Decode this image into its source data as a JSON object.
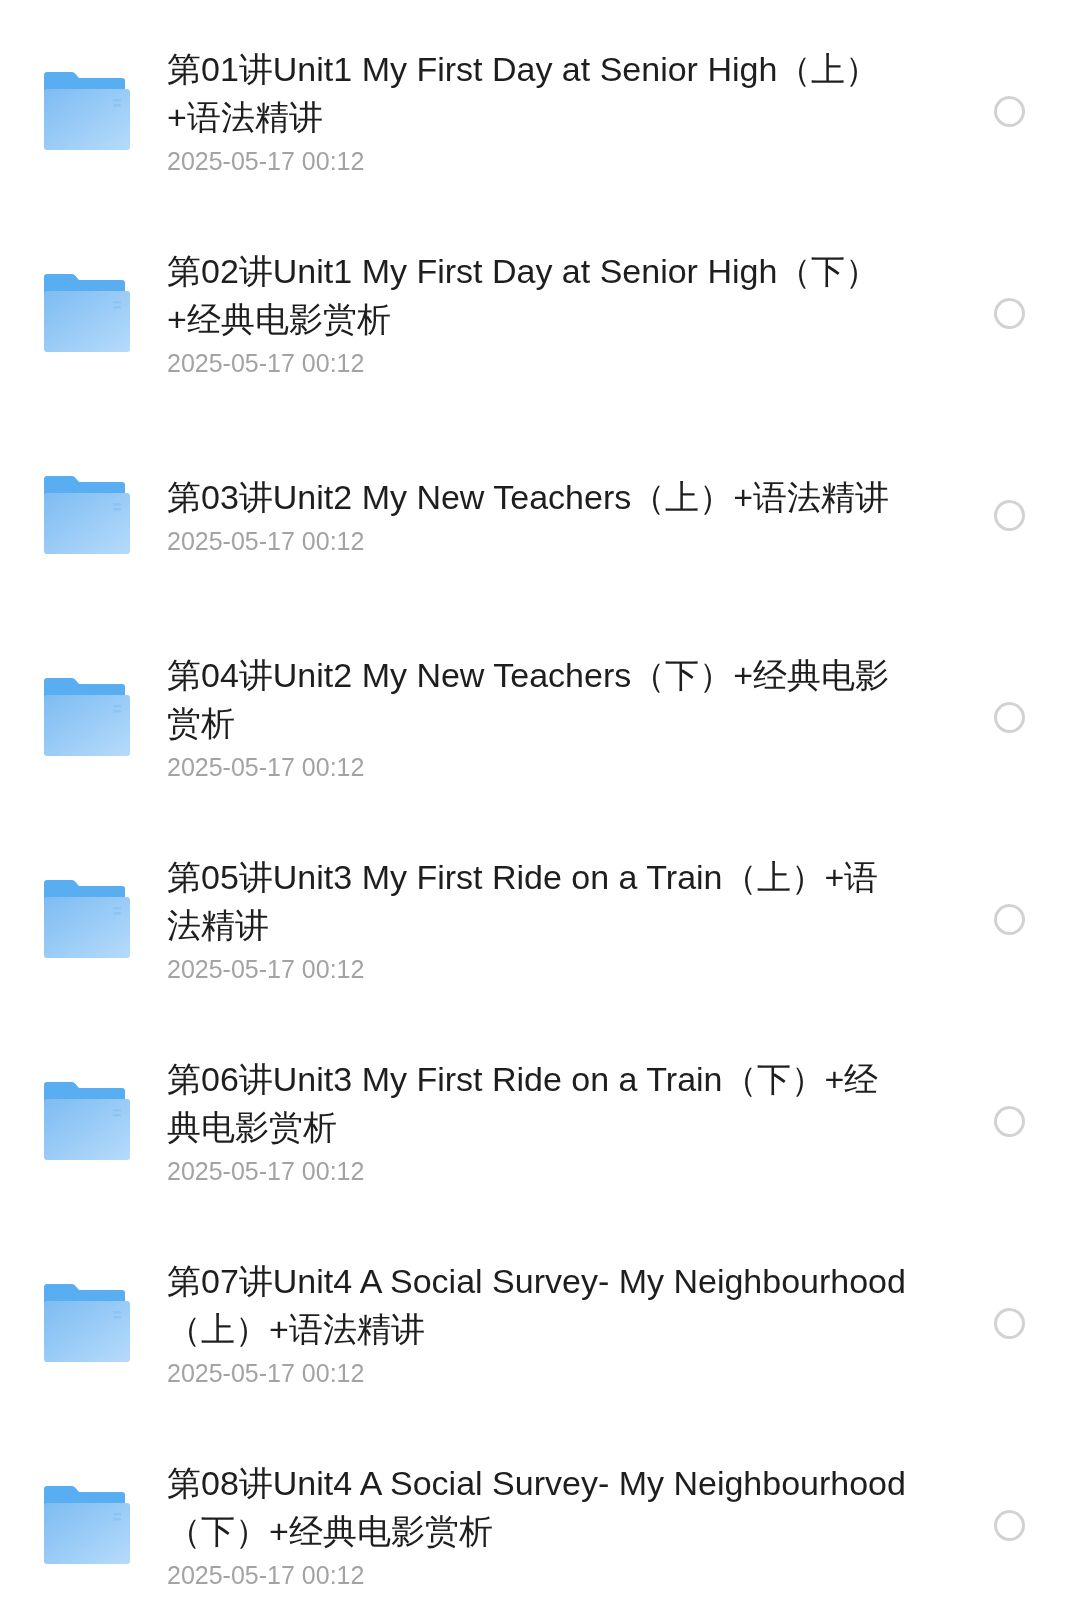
{
  "items": [
    {
      "title": "第01讲Unit1 My First Day at Senior High（上）+语法精讲",
      "date": "2025-05-17 00:12",
      "selected": false
    },
    {
      "title": "第02讲Unit1 My First Day at Senior High（下）+经典电影赏析",
      "date": "2025-05-17 00:12",
      "selected": false
    },
    {
      "title": "第03讲Unit2 My New Teachers（上）+语法精讲",
      "date": "2025-05-17 00:12",
      "selected": false
    },
    {
      "title": "第04讲Unit2 My New Teachers（下）+经典电影赏析",
      "date": "2025-05-17 00:12",
      "selected": false
    },
    {
      "title": "第05讲Unit3 My First Ride on a Train（上）+语法精讲",
      "date": "2025-05-17 00:12",
      "selected": false
    },
    {
      "title": "第06讲Unit3 My First Ride on a Train（下）+经典电影赏析",
      "date": "2025-05-17 00:12",
      "selected": false
    },
    {
      "title": "第07讲Unit4 A Social Survey- My Neighbourhood（上）+语法精讲",
      "date": "2025-05-17 00:12",
      "selected": false
    },
    {
      "title": "第08讲Unit4 A Social Survey- My Neighbourhood（下）+经典电影赏析",
      "date": "2025-05-17 00:12",
      "selected": false
    }
  ]
}
